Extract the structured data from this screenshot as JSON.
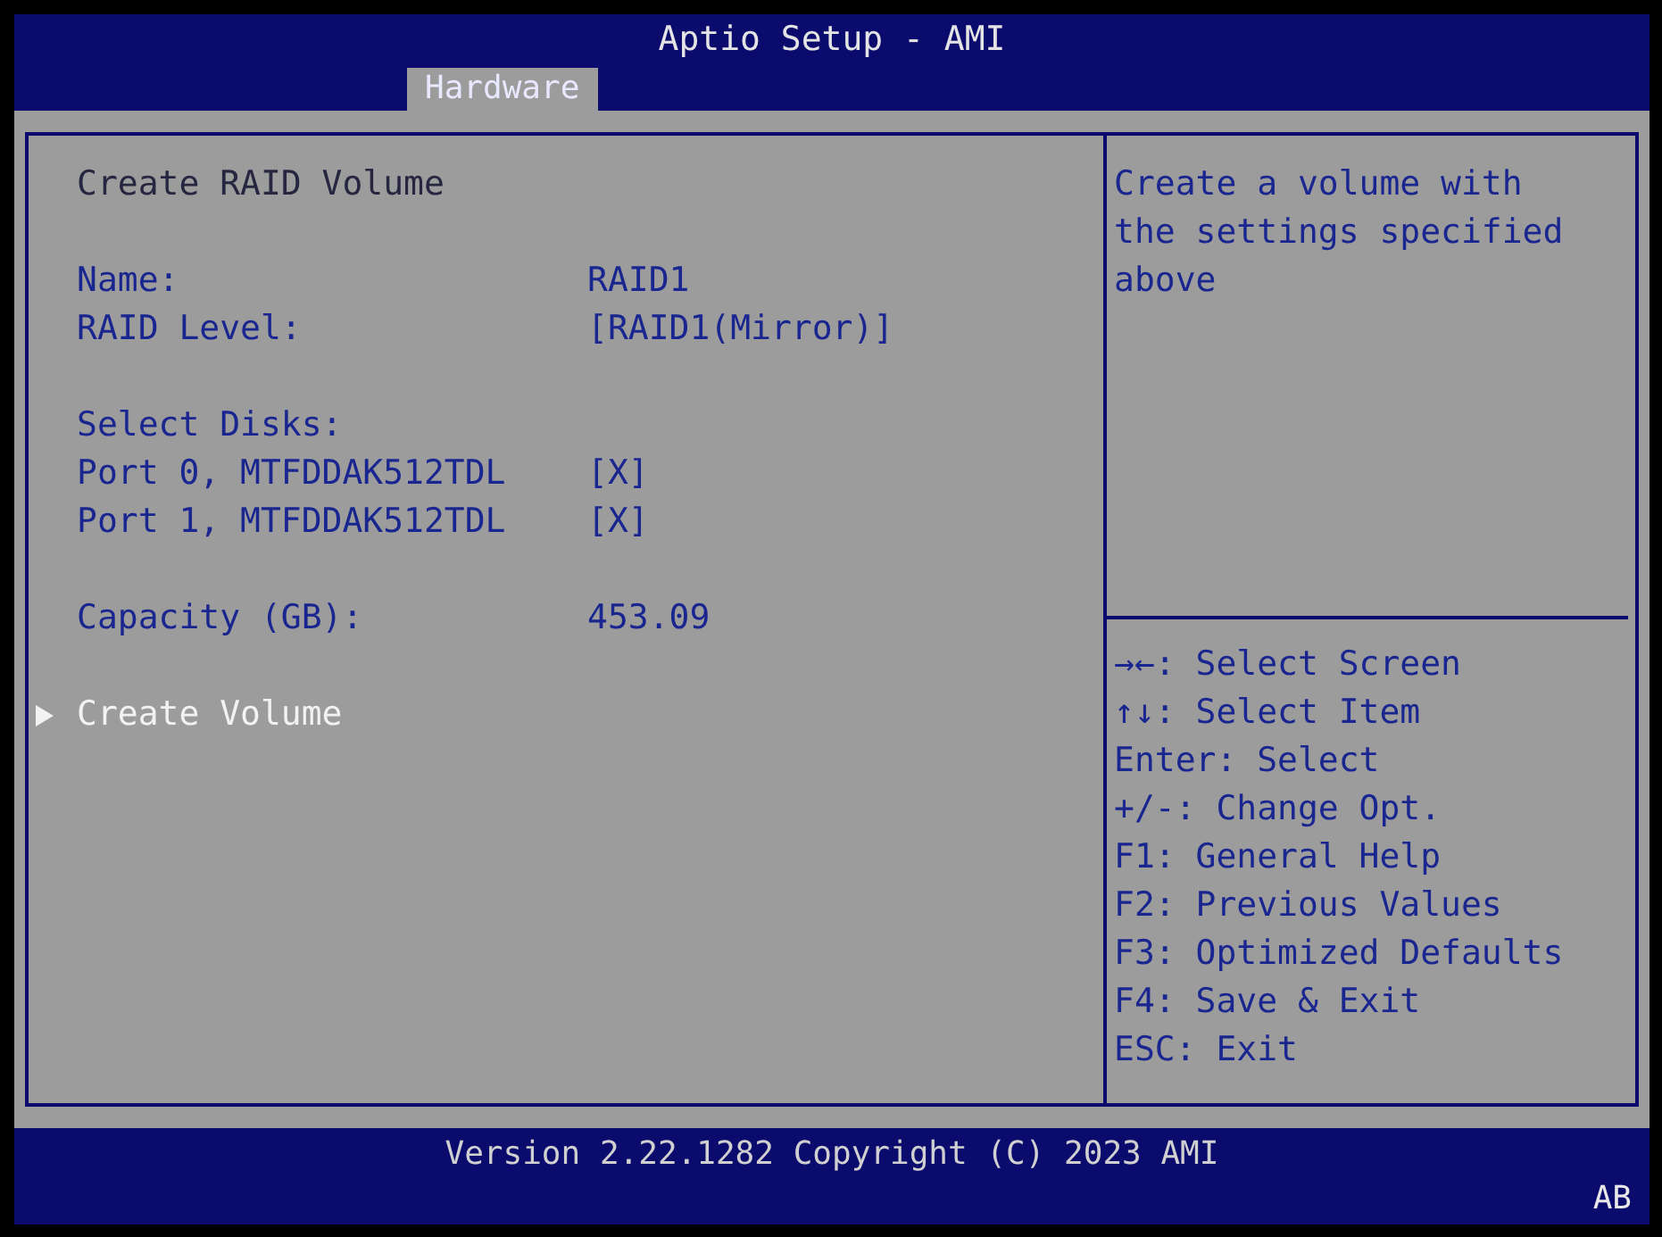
{
  "window": {
    "title": "Aptio Setup - AMI"
  },
  "tabs": [
    {
      "label": "Hardware",
      "selected": true
    }
  ],
  "form": {
    "title": "Create RAID Volume",
    "groups": [
      {
        "items": [
          {
            "kind": "field",
            "label": "Name:",
            "value": "RAID1"
          },
          {
            "kind": "field",
            "label": "RAID Level:",
            "value": "[RAID1(Mirror)]"
          }
        ]
      },
      {
        "items": [
          {
            "kind": "label",
            "label": "Select Disks:"
          },
          {
            "kind": "field",
            "label": "Port 0, MTFDDAK512TDL",
            "value": "[X]"
          },
          {
            "kind": "field",
            "label": "Port 1, MTFDDAK512TDL",
            "value": "[X]"
          }
        ]
      },
      {
        "items": [
          {
            "kind": "field",
            "label": "Capacity (GB):",
            "value": "453.09"
          }
        ]
      },
      {
        "items": [
          {
            "kind": "action",
            "label": "Create Volume",
            "selected": true
          }
        ]
      }
    ]
  },
  "help": {
    "lines": [
      "Create a volume with",
      "the settings specified",
      "above"
    ]
  },
  "keys": [
    "→←: Select Screen",
    "↑↓: Select Item",
    "Enter: Select",
    "+/-: Change Opt.",
    "F1: General Help",
    "F2: Previous Values",
    "F3: Optimized Defaults",
    "F4: Save & Exit",
    "ESC: Exit"
  ],
  "status_bar": {
    "version": "Version 2.22.1282 Copyright (C) 2023 AMI",
    "indicator": "AB"
  }
}
